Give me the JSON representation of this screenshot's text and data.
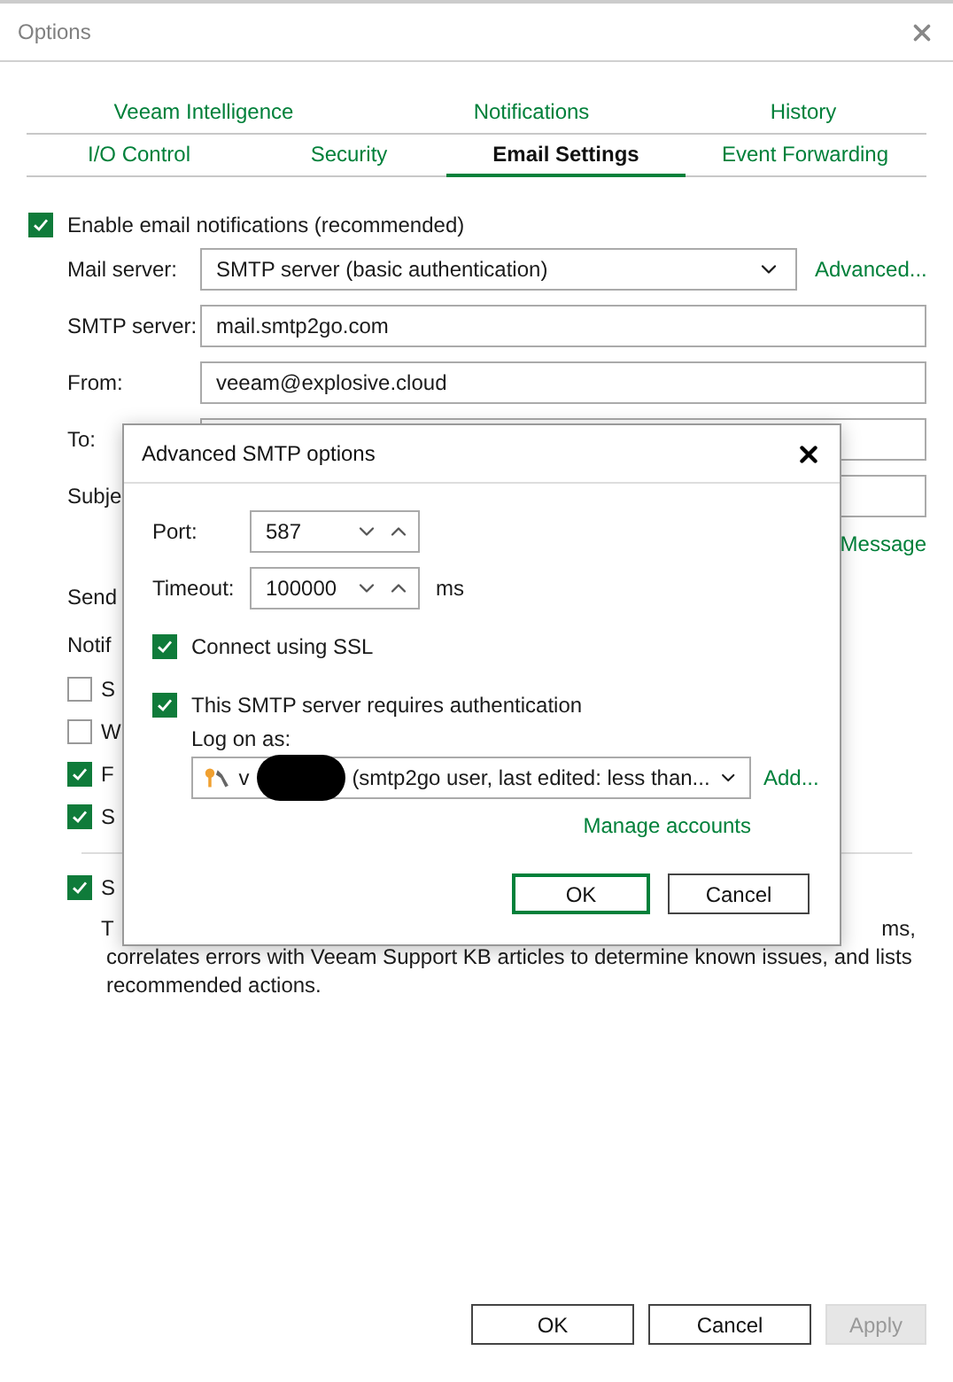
{
  "window": {
    "title": "Options"
  },
  "tabs_row_1": [
    {
      "label": "Veeam Intelligence",
      "selected": false
    },
    {
      "label": "Notifications",
      "selected": false
    },
    {
      "label": "History",
      "selected": false
    }
  ],
  "tabs_row_2": [
    {
      "label": "I/O Control",
      "selected": false
    },
    {
      "label": "Security",
      "selected": false
    },
    {
      "label": "Email Settings",
      "selected": true
    },
    {
      "label": "Event Forwarding",
      "selected": false
    }
  ],
  "email": {
    "enabled": {
      "label": "Enable email notifications (recommended)",
      "checked": true
    },
    "fields": [
      {
        "label": "Mail server:",
        "value": "SMTP server (basic authentication)",
        "kind": "dropdown"
      },
      {
        "label": "SMTP server:",
        "value": "mail.smtp2go.com",
        "kind": "text"
      },
      {
        "label": "From:",
        "value": "veeam@explosive.cloud",
        "kind": "text"
      },
      {
        "label": "To:",
        "kind": "text"
      },
      {
        "label": "Subje",
        "kind": "text"
      }
    ],
    "advanced_link": "Advanced...",
    "message_link": "Message",
    "send_label": "Send",
    "notify_label": "Notif",
    "notify_options": [
      {
        "label": "S",
        "checked": false
      },
      {
        "label": "W",
        "checked": false
      },
      {
        "label": "F",
        "checked": true
      },
      {
        "label": "S",
        "checked": true
      }
    ]
  },
  "intelligence": {
    "label": "S",
    "checked": true,
    "description_start": "T",
    "description_end": "ms,",
    "description_lines": [
      "correlates errors with Veeam Support KB articles to determine known issues, and lists",
      "recommended actions."
    ]
  },
  "buttons": [
    {
      "label": "OK",
      "disabled": false
    },
    {
      "label": "Cancel",
      "disabled": false
    },
    {
      "label": "Apply",
      "disabled": true
    }
  ],
  "dialog": {
    "title": "Advanced SMTP options",
    "port": {
      "label": "Port:",
      "value": "587"
    },
    "timeout": {
      "label": "Timeout:",
      "value": "100000",
      "unit": "ms"
    },
    "options": [
      {
        "label": "Connect using SSL",
        "checked": true
      },
      {
        "label": "This SMTP server requires authentication",
        "checked": true
      }
    ],
    "logon_label": "Log on as:",
    "account": {
      "prefix": "v",
      "value": "(smtp2go user, last edited: less than..."
    },
    "add_link": "Add...",
    "manage_link": "Manage accounts",
    "buttons": [
      {
        "label": "OK",
        "default": true
      },
      {
        "label": "Cancel",
        "default": false
      }
    ]
  }
}
